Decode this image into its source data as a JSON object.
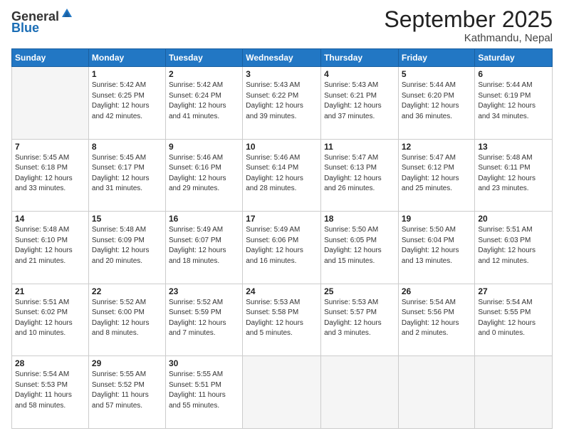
{
  "header": {
    "logo_general": "General",
    "logo_blue": "Blue",
    "month_title": "September 2025",
    "subtitle": "Kathmandu, Nepal"
  },
  "days_of_week": [
    "Sunday",
    "Monday",
    "Tuesday",
    "Wednesday",
    "Thursday",
    "Friday",
    "Saturday"
  ],
  "weeks": [
    [
      {
        "day": "",
        "info": ""
      },
      {
        "day": "1",
        "info": "Sunrise: 5:42 AM\nSunset: 6:25 PM\nDaylight: 12 hours\nand 42 minutes."
      },
      {
        "day": "2",
        "info": "Sunrise: 5:42 AM\nSunset: 6:24 PM\nDaylight: 12 hours\nand 41 minutes."
      },
      {
        "day": "3",
        "info": "Sunrise: 5:43 AM\nSunset: 6:22 PM\nDaylight: 12 hours\nand 39 minutes."
      },
      {
        "day": "4",
        "info": "Sunrise: 5:43 AM\nSunset: 6:21 PM\nDaylight: 12 hours\nand 37 minutes."
      },
      {
        "day": "5",
        "info": "Sunrise: 5:44 AM\nSunset: 6:20 PM\nDaylight: 12 hours\nand 36 minutes."
      },
      {
        "day": "6",
        "info": "Sunrise: 5:44 AM\nSunset: 6:19 PM\nDaylight: 12 hours\nand 34 minutes."
      }
    ],
    [
      {
        "day": "7",
        "info": "Sunrise: 5:45 AM\nSunset: 6:18 PM\nDaylight: 12 hours\nand 33 minutes."
      },
      {
        "day": "8",
        "info": "Sunrise: 5:45 AM\nSunset: 6:17 PM\nDaylight: 12 hours\nand 31 minutes."
      },
      {
        "day": "9",
        "info": "Sunrise: 5:46 AM\nSunset: 6:16 PM\nDaylight: 12 hours\nand 29 minutes."
      },
      {
        "day": "10",
        "info": "Sunrise: 5:46 AM\nSunset: 6:14 PM\nDaylight: 12 hours\nand 28 minutes."
      },
      {
        "day": "11",
        "info": "Sunrise: 5:47 AM\nSunset: 6:13 PM\nDaylight: 12 hours\nand 26 minutes."
      },
      {
        "day": "12",
        "info": "Sunrise: 5:47 AM\nSunset: 6:12 PM\nDaylight: 12 hours\nand 25 minutes."
      },
      {
        "day": "13",
        "info": "Sunrise: 5:48 AM\nSunset: 6:11 PM\nDaylight: 12 hours\nand 23 minutes."
      }
    ],
    [
      {
        "day": "14",
        "info": "Sunrise: 5:48 AM\nSunset: 6:10 PM\nDaylight: 12 hours\nand 21 minutes."
      },
      {
        "day": "15",
        "info": "Sunrise: 5:48 AM\nSunset: 6:09 PM\nDaylight: 12 hours\nand 20 minutes."
      },
      {
        "day": "16",
        "info": "Sunrise: 5:49 AM\nSunset: 6:07 PM\nDaylight: 12 hours\nand 18 minutes."
      },
      {
        "day": "17",
        "info": "Sunrise: 5:49 AM\nSunset: 6:06 PM\nDaylight: 12 hours\nand 16 minutes."
      },
      {
        "day": "18",
        "info": "Sunrise: 5:50 AM\nSunset: 6:05 PM\nDaylight: 12 hours\nand 15 minutes."
      },
      {
        "day": "19",
        "info": "Sunrise: 5:50 AM\nSunset: 6:04 PM\nDaylight: 12 hours\nand 13 minutes."
      },
      {
        "day": "20",
        "info": "Sunrise: 5:51 AM\nSunset: 6:03 PM\nDaylight: 12 hours\nand 12 minutes."
      }
    ],
    [
      {
        "day": "21",
        "info": "Sunrise: 5:51 AM\nSunset: 6:02 PM\nDaylight: 12 hours\nand 10 minutes."
      },
      {
        "day": "22",
        "info": "Sunrise: 5:52 AM\nSunset: 6:00 PM\nDaylight: 12 hours\nand 8 minutes."
      },
      {
        "day": "23",
        "info": "Sunrise: 5:52 AM\nSunset: 5:59 PM\nDaylight: 12 hours\nand 7 minutes."
      },
      {
        "day": "24",
        "info": "Sunrise: 5:53 AM\nSunset: 5:58 PM\nDaylight: 12 hours\nand 5 minutes."
      },
      {
        "day": "25",
        "info": "Sunrise: 5:53 AM\nSunset: 5:57 PM\nDaylight: 12 hours\nand 3 minutes."
      },
      {
        "day": "26",
        "info": "Sunrise: 5:54 AM\nSunset: 5:56 PM\nDaylight: 12 hours\nand 2 minutes."
      },
      {
        "day": "27",
        "info": "Sunrise: 5:54 AM\nSunset: 5:55 PM\nDaylight: 12 hours\nand 0 minutes."
      }
    ],
    [
      {
        "day": "28",
        "info": "Sunrise: 5:54 AM\nSunset: 5:53 PM\nDaylight: 11 hours\nand 58 minutes."
      },
      {
        "day": "29",
        "info": "Sunrise: 5:55 AM\nSunset: 5:52 PM\nDaylight: 11 hours\nand 57 minutes."
      },
      {
        "day": "30",
        "info": "Sunrise: 5:55 AM\nSunset: 5:51 PM\nDaylight: 11 hours\nand 55 minutes."
      },
      {
        "day": "",
        "info": ""
      },
      {
        "day": "",
        "info": ""
      },
      {
        "day": "",
        "info": ""
      },
      {
        "day": "",
        "info": ""
      }
    ]
  ]
}
